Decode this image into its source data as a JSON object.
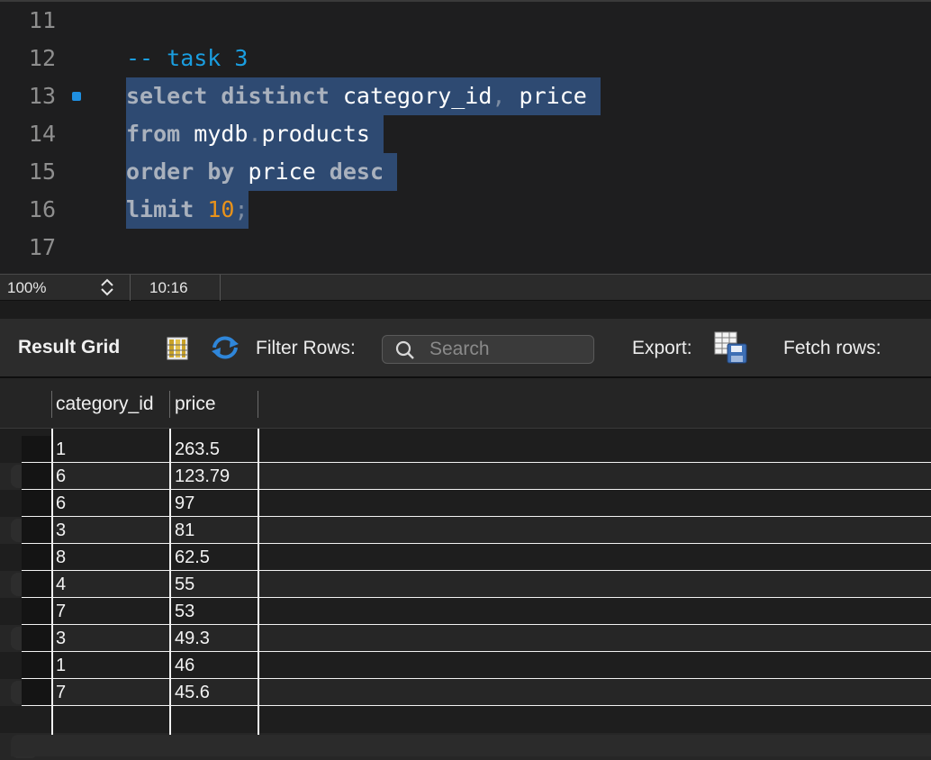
{
  "editor": {
    "lines": [
      {
        "num": "11",
        "tokens": []
      },
      {
        "num": "12",
        "tokens": [
          {
            "t": "-- task 3",
            "c": "cm"
          }
        ]
      },
      {
        "num": "13",
        "breakpoint": true,
        "selected": true,
        "tokens": [
          {
            "t": "select",
            "c": "kw"
          },
          {
            "t": " ",
            "c": "id"
          },
          {
            "t": "distinct",
            "c": "kw"
          },
          {
            "t": " category_id",
            "c": "id"
          },
          {
            "t": ",",
            "c": "pn"
          },
          {
            "t": " price ",
            "c": "id"
          }
        ]
      },
      {
        "num": "14",
        "selected": true,
        "tokens": [
          {
            "t": "from",
            "c": "kw"
          },
          {
            "t": " mydb",
            "c": "id"
          },
          {
            "t": ".",
            "c": "pn"
          },
          {
            "t": "products ",
            "c": "id"
          }
        ]
      },
      {
        "num": "15",
        "selected": true,
        "tokens": [
          {
            "t": "order",
            "c": "kw"
          },
          {
            "t": " ",
            "c": "id"
          },
          {
            "t": "by",
            "c": "kw"
          },
          {
            "t": " price ",
            "c": "id"
          },
          {
            "t": "desc",
            "c": "kw"
          },
          {
            "t": " ",
            "c": "id"
          }
        ]
      },
      {
        "num": "16",
        "selected": true,
        "tokens": [
          {
            "t": "limit",
            "c": "kw"
          },
          {
            "t": " ",
            "c": "id"
          },
          {
            "t": "10",
            "c": "num"
          },
          {
            "t": ";",
            "c": "pn"
          }
        ]
      },
      {
        "num": "17",
        "tokens": []
      }
    ],
    "colors": {
      "selection": "#2e4a72",
      "comment": "#1a9ee0",
      "number": "#e8921a",
      "breakpoint": "#1f8fe0"
    }
  },
  "status": {
    "zoom": "100%",
    "cursor": "10:16"
  },
  "toolbar": {
    "result_grid_label": "Result Grid",
    "grid_icon": "grid-view-icon",
    "refresh_icon": "refresh-icon",
    "filter_label": "Filter Rows:",
    "search_placeholder": "Search",
    "export_label": "Export:",
    "export_icon": "export-table-icon",
    "fetch_label": "Fetch rows:"
  },
  "grid": {
    "columns": [
      "category_id",
      "price"
    ],
    "rows": [
      [
        "1",
        "263.5"
      ],
      [
        "6",
        "123.79"
      ],
      [
        "6",
        "97"
      ],
      [
        "3",
        "81"
      ],
      [
        "8",
        "62.5"
      ],
      [
        "4",
        "55"
      ],
      [
        "7",
        "53"
      ],
      [
        "3",
        "49.3"
      ],
      [
        "1",
        "46"
      ],
      [
        "7",
        "45.6"
      ]
    ]
  }
}
